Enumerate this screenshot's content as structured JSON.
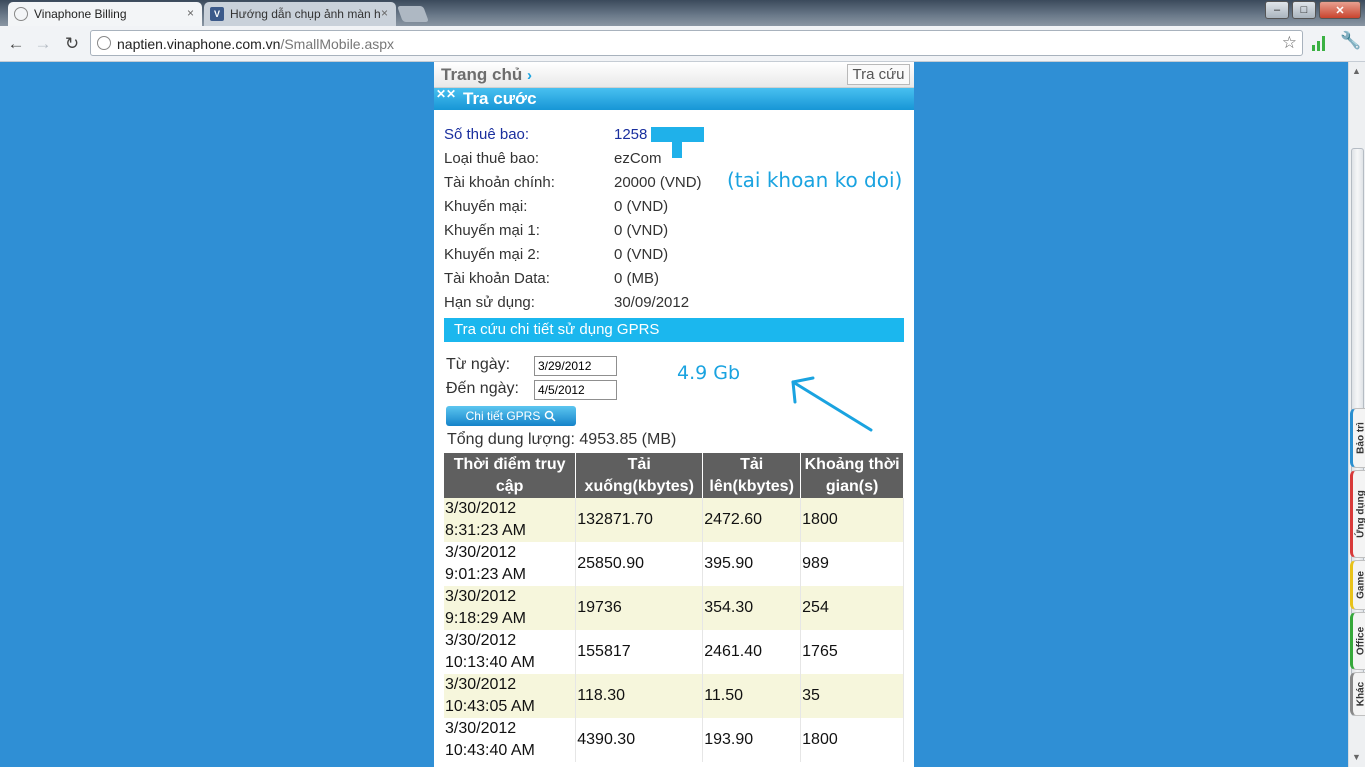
{
  "browser": {
    "tabs": [
      {
        "label": "Vinaphone Billing",
        "close": "×"
      },
      {
        "label": "Hướng dẫn chụp ảnh màn hình",
        "close": "×"
      }
    ],
    "window_buttons": {
      "minimize": "–",
      "maximize": "□",
      "close": "✕"
    },
    "url_host": "naptien.vinaphone.com.vn",
    "url_path": "/SmallMobile.aspx"
  },
  "page": {
    "home_label": "Trang chủ",
    "home_chevron": "›",
    "lookup_button": "Tra cứu",
    "section_title": "Tra cước",
    "info": [
      {
        "label": "Số thuê bao:",
        "value": "1258"
      },
      {
        "label": "Loại thuê bao:",
        "value": "ezCom"
      },
      {
        "label": "Tài khoản chính:",
        "value": "20000 (VND)"
      },
      {
        "label": "Khuyến mại:",
        "value": "0 (VND)"
      },
      {
        "label": "Khuyến mại 1:",
        "value": "0 (VND)"
      },
      {
        "label": "Khuyến mại 2:",
        "value": "0 (VND)"
      },
      {
        "label": "Tài khoản Data:",
        "value": "0 (MB)"
      },
      {
        "label": "Hạn sử dụng:",
        "value": "30/09/2012"
      }
    ],
    "annotation_account": "(tai khoan ko doi)",
    "annotation_usage": "4.9 Gb",
    "gprs_header": "Tra cứu chi tiết sử dụng GPRS",
    "from_label": "Từ ngày:",
    "from_value": "3/29/2012",
    "to_label": "Đến ngày:",
    "to_value": "4/5/2012",
    "gprs_button": "Chi tiết GPRS",
    "total_usage": "Tổng dung lượng: 4953.85 (MB)",
    "table": {
      "headers": [
        "Thời điểm truy cập",
        "Tải xuống(kbytes)",
        "Tải lên(kbytes)",
        "Khoảng thời gian(s)"
      ],
      "rows": [
        {
          "date": "3/30/2012",
          "time": "8:31:23 AM",
          "down": "132871.70",
          "up": "2472.60",
          "dur": "1800"
        },
        {
          "date": "3/30/2012",
          "time": "9:01:23 AM",
          "down": "25850.90",
          "up": "395.90",
          "dur": "989"
        },
        {
          "date": "3/30/2012",
          "time": "9:18:29 AM",
          "down": "19736",
          "up": "354.30",
          "dur": "254"
        },
        {
          "date": "3/30/2012",
          "time": "10:13:40 AM",
          "down": "155817",
          "up": "2461.40",
          "dur": "1765"
        },
        {
          "date": "3/30/2012",
          "time": "10:43:05 AM",
          "down": "118.30",
          "up": "11.50",
          "dur": "35"
        },
        {
          "date": "3/30/2012",
          "time": "10:43:40 AM",
          "down": "4390.30",
          "up": "193.90",
          "dur": "1800"
        }
      ]
    }
  },
  "side_tabs": [
    "Bảo trì",
    "Ứng dụng",
    "Game",
    "Office",
    "Khác"
  ],
  "colors": {
    "page_bg": "#2f8fd5",
    "accent": "#1bb7ee",
    "table_header": "#5f5f5f",
    "row_alt": "#f6f6dc"
  }
}
